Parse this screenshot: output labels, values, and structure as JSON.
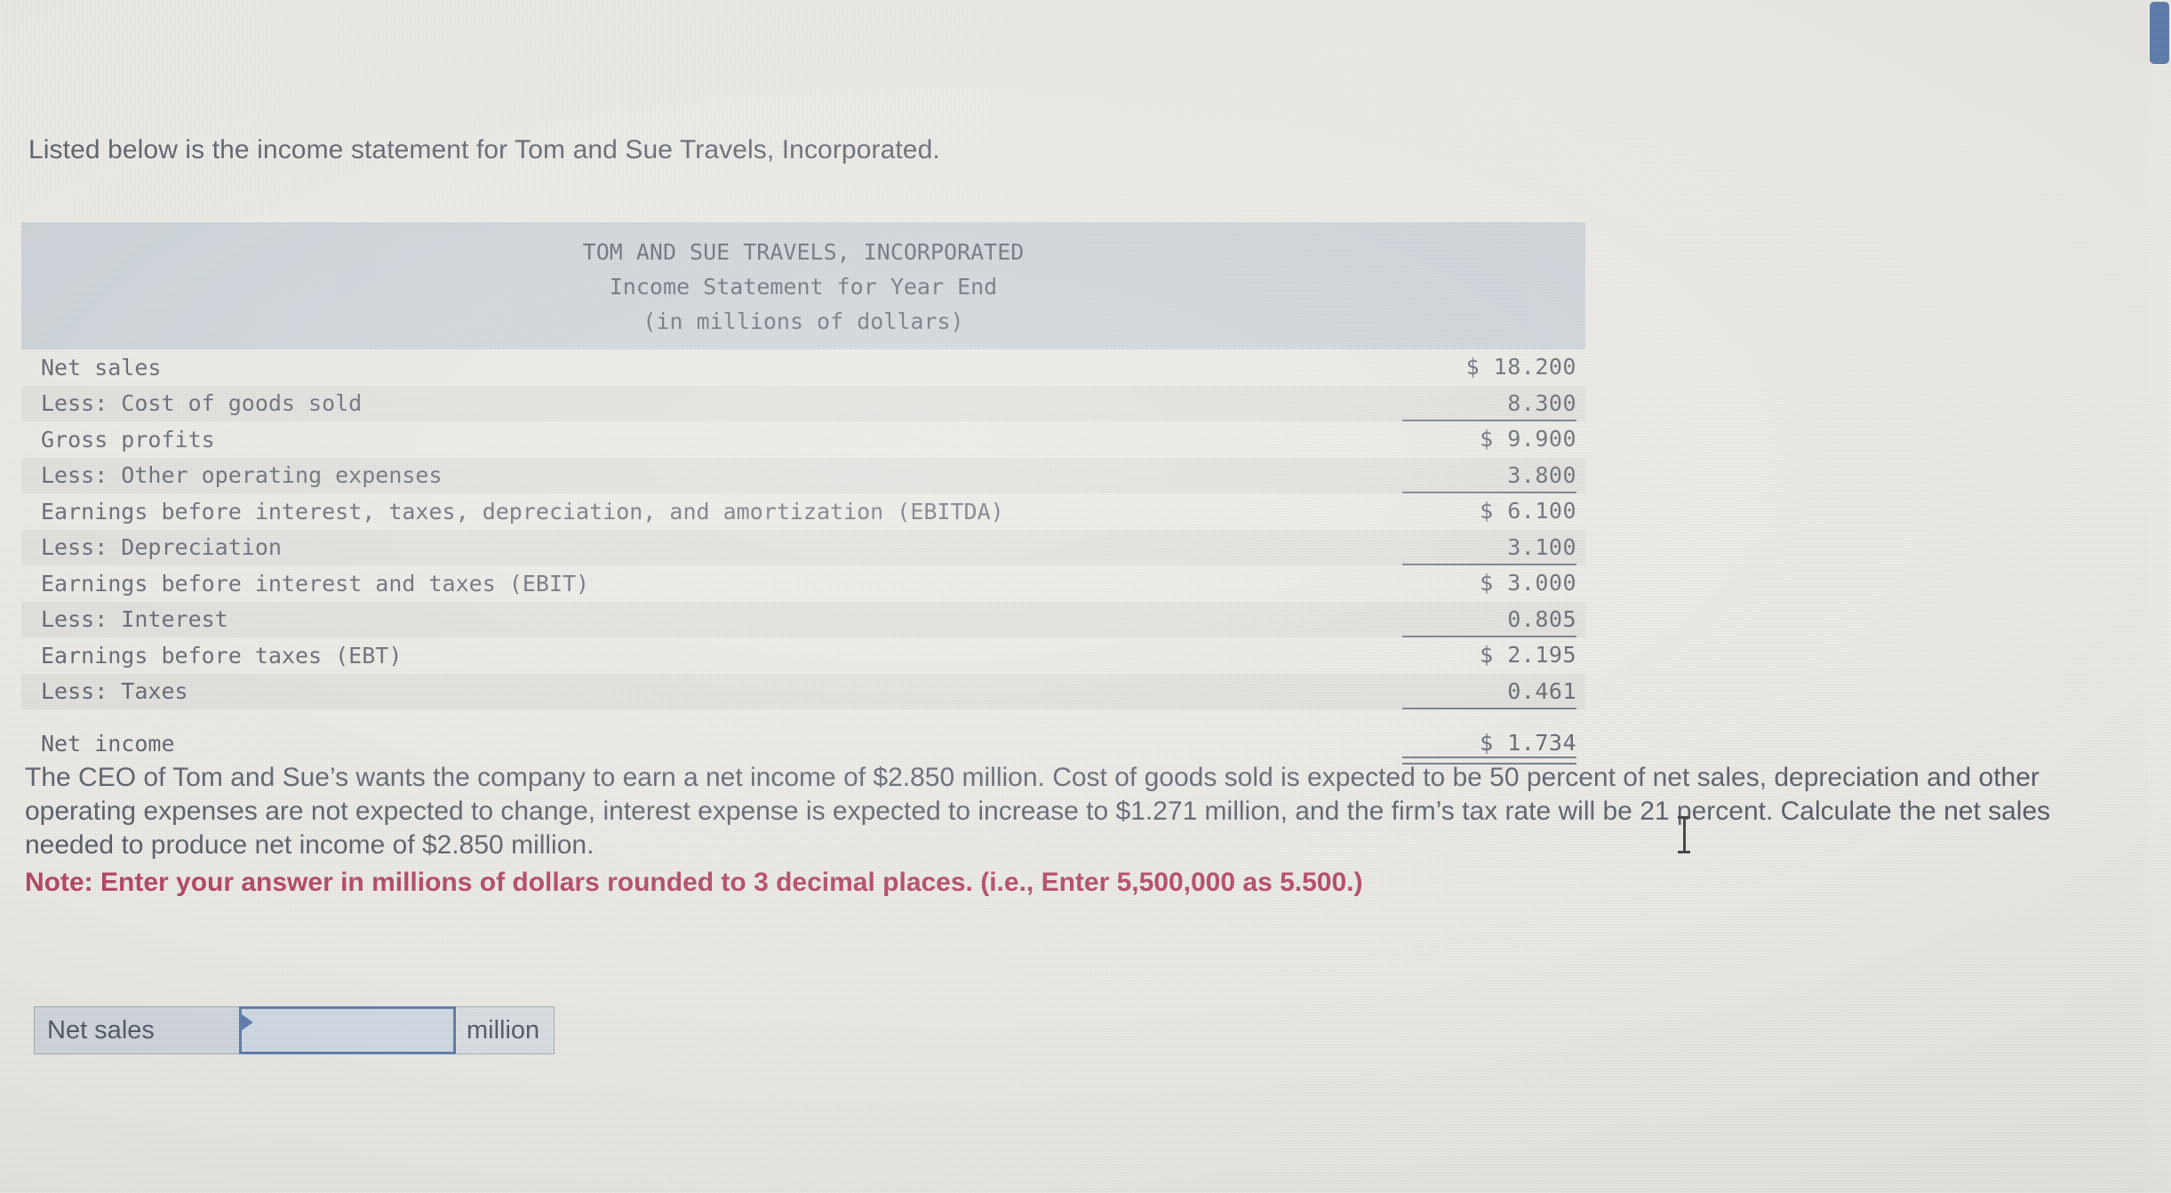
{
  "intro": "Listed below is the income statement for Tom and Sue Travels, Incorporated.",
  "statement": {
    "header": {
      "line1": "TOM AND SUE TRAVELS, INCORPORATED",
      "line2": "Income Statement for Year End",
      "line3": "(in millions of dollars)"
    },
    "rows": [
      {
        "label": "Net sales",
        "value": "$ 18.200",
        "shaded": false,
        "rule": "none"
      },
      {
        "label": "Less: Cost of goods sold",
        "value": "8.300",
        "shaded": true,
        "rule": "single"
      },
      {
        "label": "Gross profits",
        "value": "$ 9.900",
        "shaded": false,
        "rule": "none"
      },
      {
        "label": "Less: Other operating expenses",
        "value": "3.800",
        "shaded": true,
        "rule": "single"
      },
      {
        "label": "Earnings before interest, taxes, depreciation, and amortization (EBITDA)",
        "value": "$ 6.100",
        "shaded": false,
        "rule": "none"
      },
      {
        "label": "Less: Depreciation",
        "value": "3.100",
        "shaded": true,
        "rule": "single"
      },
      {
        "label": "Earnings before interest and taxes (EBIT)",
        "value": "$ 3.000",
        "shaded": false,
        "rule": "none"
      },
      {
        "label": "Less: Interest",
        "value": "0.805",
        "shaded": true,
        "rule": "single"
      },
      {
        "label": "Earnings before taxes (EBT)",
        "value": "$ 2.195",
        "shaded": false,
        "rule": "none"
      },
      {
        "label": "Less: Taxes",
        "value": "0.461",
        "shaded": true,
        "rule": "single"
      },
      {
        "label": "Net income",
        "value": "$ 1.734",
        "shaded": false,
        "rule": "double"
      }
    ]
  },
  "question": {
    "body": "The CEO of Tom and Sue’s wants the company to earn a net income of $2.850 million. Cost of goods sold is expected to be 50 percent of net sales, depreciation and other operating expenses are not expected to change, interest expense is expected to increase to $1.271 million, and the firm’s tax rate will be 21 percent. Calculate the net sales needed to produce net income of $2.850 million.",
    "note": "Note: Enter your answer in millions of dollars rounded to 3 decimal places. (i.e., Enter 5,500,000 as 5.500.)",
    "note_color": "#a92b4b"
  },
  "answer": {
    "label": "Net sales",
    "value": "",
    "placeholder": "",
    "unit": "million",
    "border_color": "#4a6da4"
  },
  "chrome": {
    "scrollbar_color": "#4a6da4",
    "page_background": "#e8e7e1",
    "header_band_color": "#c3cbd1"
  }
}
